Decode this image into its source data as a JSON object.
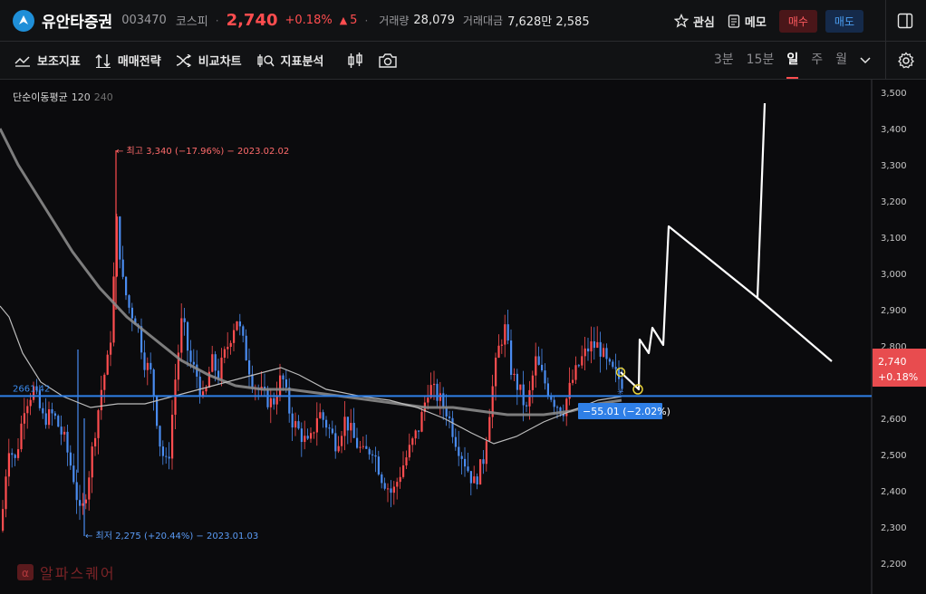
{
  "header": {
    "stock_name": "유안타증권",
    "stock_code": "003470",
    "market": "코스피",
    "price": "2,740",
    "change_pct": "+0.18%",
    "change_value": "5",
    "volume_label": "거래량",
    "volume": "28,079",
    "amount_label": "거래대금",
    "amount": "7,628만 2,585",
    "watch_label": "관심",
    "memo_label": "메모",
    "buy_label": "매수",
    "sell_label": "매도"
  },
  "toolbar": {
    "items": [
      "보조지표",
      "매매전략",
      "비교차트",
      "지표분석"
    ],
    "periods": [
      "3분",
      "15분",
      "일",
      "주",
      "월"
    ],
    "active_period": "일"
  },
  "indicator": {
    "name": "단순이동평균",
    "p1": "120",
    "p2": "240"
  },
  "chart_data": {
    "type": "candlestick",
    "y_ticks": [
      "3,500",
      "3,400",
      "3,300",
      "3,200",
      "3,100",
      "3,000",
      "2,900",
      "2,800",
      "2,700",
      "2,600",
      "2,500",
      "2,400",
      "2,300",
      "2,200"
    ],
    "ylim": [
      2170,
      3540
    ],
    "current_price_tag": {
      "price": "2,740",
      "pct": "+0.18%"
    },
    "horizontal_line": {
      "label": "2661.42",
      "value": 2661.42
    },
    "measure_label": "−55.01  (−2.02%)",
    "high_annotation": "← 최고 3,340 (−17.96%) − 2023.02.02",
    "low_annotation": "← 최저 2,275 (+20.44%) − 2023.01.03",
    "colors": {
      "up": "#ff4d4f",
      "down": "#4a8cf0",
      "hline": "#2f7fe6",
      "ma120": "#8a8a8a",
      "ma240": "#bdbdbd"
    }
  },
  "watermark": "알파스퀘어"
}
